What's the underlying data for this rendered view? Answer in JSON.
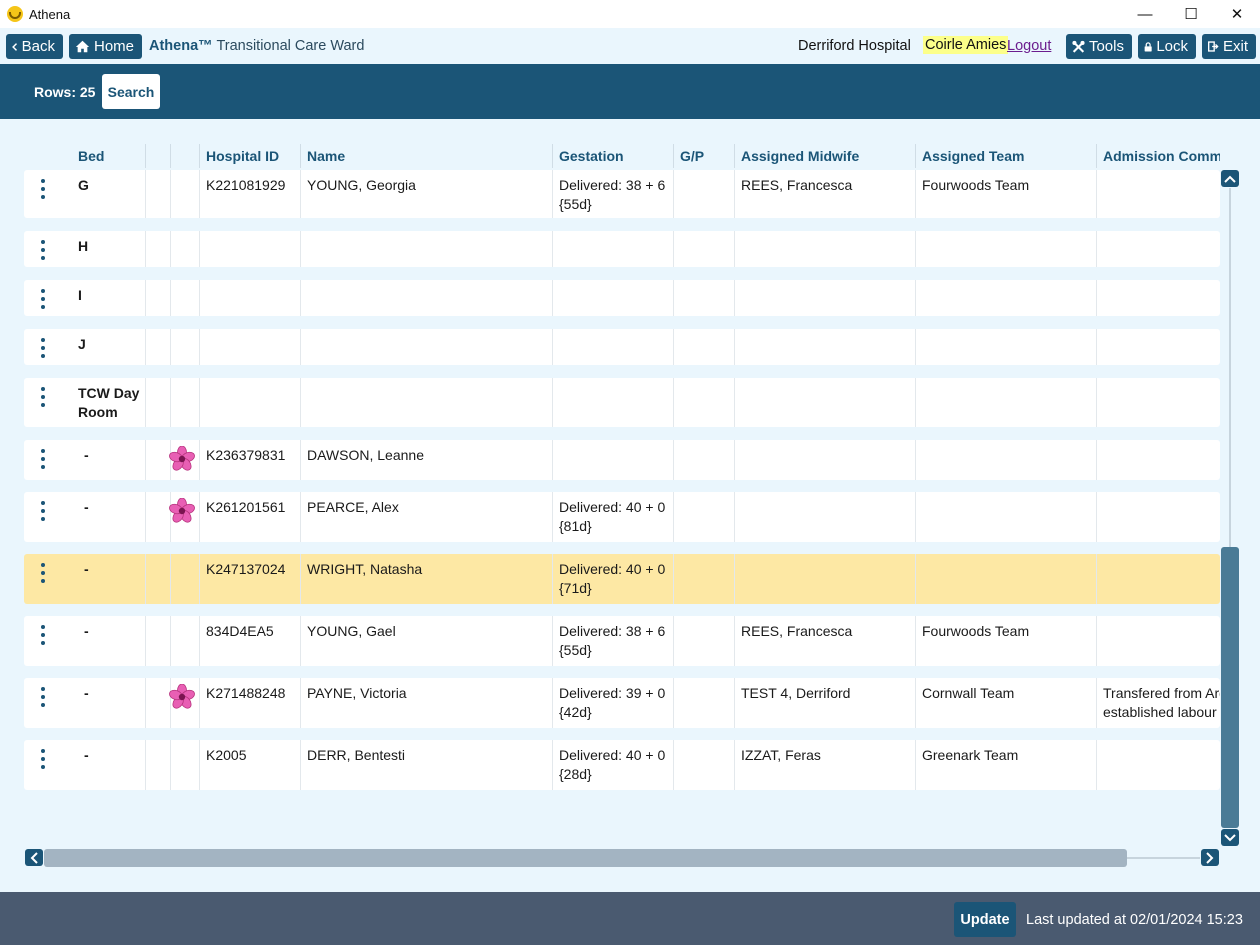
{
  "window": {
    "title": "Athena",
    "minimize_glyph": "—",
    "maximize_glyph": "☐",
    "close_glyph": "✕"
  },
  "toolbar": {
    "back_label": "Back",
    "home_label": "Home",
    "ward_brand": "Athena™",
    "ward_name": "Transitional Care Ward",
    "hospital": "Derriford Hospital",
    "user": "Coirle Amies",
    "logout_label": "Logout",
    "tools_label": "Tools",
    "lock_label": "Lock",
    "exit_label": "Exit"
  },
  "search": {
    "rows_label": "Rows: 25",
    "search_label": "Search"
  },
  "grid": {
    "columns": [
      "Bed",
      "",
      "",
      "Hospital ID",
      "Name",
      "Gestation",
      "G/P",
      "Assigned Midwife",
      "Assigned Team",
      "Admission Comm"
    ],
    "rows": [
      {
        "bed": "G",
        "bed2": "",
        "flower": false,
        "id": "K221081929",
        "name": "YOUNG, Georgia",
        "gest1": "Delivered: 38 + 6",
        "gest2": "{55d}",
        "gp": "",
        "midwife": "REES, Francesca",
        "team": "Fourwoods Team",
        "comm1": "",
        "comm2": "",
        "highlight": false
      },
      {
        "bed": "H",
        "bed2": "",
        "flower": false,
        "id": "",
        "name": "",
        "gest1": "",
        "gest2": "",
        "gp": "",
        "midwife": "",
        "team": "",
        "comm1": "",
        "comm2": "",
        "highlight": false
      },
      {
        "bed": "I",
        "bed2": "",
        "flower": false,
        "id": "",
        "name": "",
        "gest1": "",
        "gest2": "",
        "gp": "",
        "midwife": "",
        "team": "",
        "comm1": "",
        "comm2": "",
        "highlight": false
      },
      {
        "bed": "J",
        "bed2": "",
        "flower": false,
        "id": "",
        "name": "",
        "gest1": "",
        "gest2": "",
        "gp": "",
        "midwife": "",
        "team": "",
        "comm1": "",
        "comm2": "",
        "highlight": false
      },
      {
        "bed": "TCW Day",
        "bed2": "Room",
        "flower": false,
        "id": "",
        "name": "",
        "gest1": "",
        "gest2": "",
        "gp": "",
        "midwife": "",
        "team": "",
        "comm1": "",
        "comm2": "",
        "highlight": false
      },
      {
        "bed": "-",
        "bed2": "",
        "flower": true,
        "id": "K236379831",
        "name": "DAWSON, Leanne",
        "gest1": "",
        "gest2": "",
        "gp": "",
        "midwife": "",
        "team": "",
        "comm1": "",
        "comm2": "",
        "highlight": false
      },
      {
        "bed": "-",
        "bed2": "",
        "flower": true,
        "id": "K261201561",
        "name": "PEARCE, Alex",
        "gest1": "Delivered: 40 + 0",
        "gest2": "{81d}",
        "gp": "",
        "midwife": "",
        "team": "",
        "comm1": "",
        "comm2": "",
        "highlight": false
      },
      {
        "bed": "-",
        "bed2": "",
        "flower": false,
        "id": "K247137024",
        "name": "WRIGHT, Natasha",
        "gest1": "Delivered: 40 + 0",
        "gest2": "{71d}",
        "gp": "",
        "midwife": "",
        "team": "",
        "comm1": "",
        "comm2": "",
        "highlight": true
      },
      {
        "bed": "-",
        "bed2": "",
        "flower": false,
        "id": "834D4EA5",
        "name": "YOUNG, Gael",
        "gest1": "Delivered: 38 + 6",
        "gest2": "{55d}",
        "gp": "",
        "midwife": "REES, Francesca",
        "team": "Fourwoods Team",
        "comm1": "",
        "comm2": "",
        "highlight": false
      },
      {
        "bed": "-",
        "bed2": "",
        "flower": true,
        "id": "K271488248",
        "name": "PAYNE, Victoria",
        "gest1": "Delivered: 39 + 0",
        "gest2": "{42d}",
        "gp": "",
        "midwife": "TEST 4, Derriford",
        "team": "Cornwall Team",
        "comm1": "Transfered from Arg",
        "comm2": "established labour",
        "highlight": false
      },
      {
        "bed": "-",
        "bed2": "",
        "flower": false,
        "id": "K2005",
        "name": "DERR, Bentesti",
        "gest1": "Delivered: 40 + 0",
        "gest2": "{28d}",
        "gp": "",
        "midwife": "IZZAT, Feras",
        "team": "Greenark Team",
        "comm1": "",
        "comm2": "",
        "highlight": false
      }
    ]
  },
  "footer": {
    "update_label": "Update",
    "last_updated": "Last updated at 02/01/2024 15:23"
  },
  "colors": {
    "primary": "#1b5577",
    "background": "#eaf6fd",
    "highlight_row": "#fde8a4",
    "footer": "#4a5a70",
    "user_highlight": "#fcff8a",
    "flower": "#e85fb4"
  }
}
